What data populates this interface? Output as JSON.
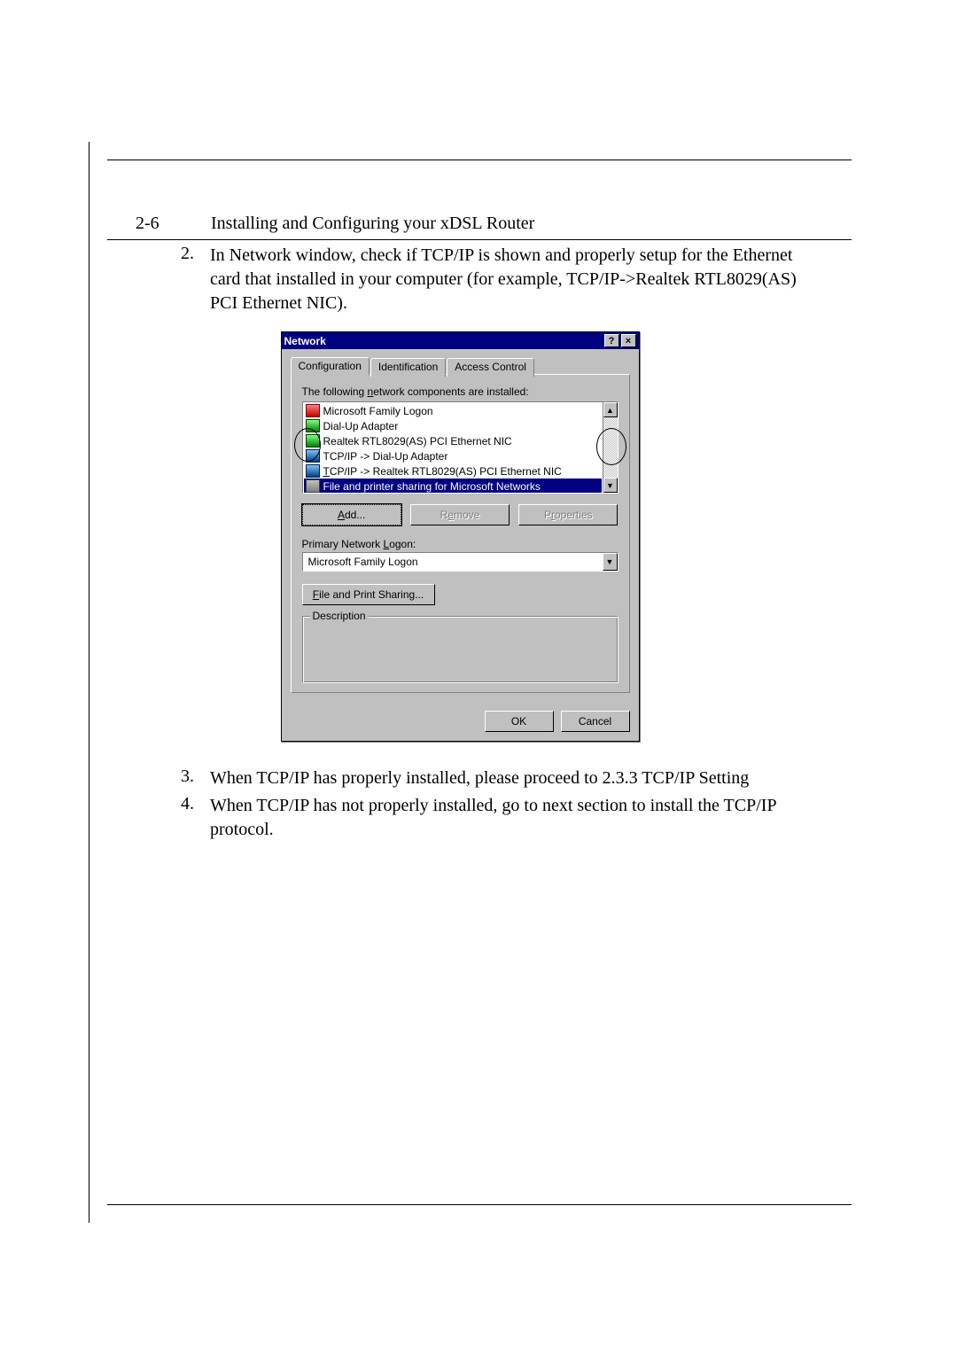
{
  "header": {
    "page_number": "2-6",
    "title": "Installing and Configuring your xDSL Router"
  },
  "steps": {
    "s2": {
      "num": "2.",
      "text": "In Network window, check if TCP/IP is shown and properly setup for the Ethernet card that installed in your computer (for example, TCP/IP->Realtek RTL8029(AS) PCI Ethernet NIC)."
    },
    "s3": {
      "num": "3.",
      "text": "When TCP/IP has properly installed, please proceed to 2.3.3 TCP/IP Setting"
    },
    "s4": {
      "num": "4.",
      "text": "When TCP/IP has not properly installed, go to next section to install the TCP/IP protocol."
    }
  },
  "dialog": {
    "title": "Network",
    "help_btn": "?",
    "close_btn": "×",
    "tabs": {
      "t1": "Configuration",
      "t2": "Identification",
      "t3": "Access Control"
    },
    "installed_label": "The following network components are installed:",
    "components": {
      "c0": "Microsoft Family Logon",
      "c1": "Dial-Up Adapter",
      "c2": "Realtek RTL8029(AS) PCI Ethernet NIC",
      "c3": "TCP/IP -> Dial-Up Adapter",
      "c4": "TCP/IP -> Realtek RTL8029(AS) PCI Ethernet NIC",
      "c5": "File and printer sharing for Microsoft Networks"
    },
    "buttons": {
      "add": "Add...",
      "remove": "Remove",
      "properties": "Properties"
    },
    "logon_label": "Primary Network Logon:",
    "logon_value": "Microsoft Family Logon",
    "fps_button": "File and Print Sharing...",
    "desc_label": "Description",
    "ok": "OK",
    "cancel": "Cancel",
    "scroll_up": "▲",
    "scroll_down": "▼",
    "combo_arrow": "▼"
  }
}
